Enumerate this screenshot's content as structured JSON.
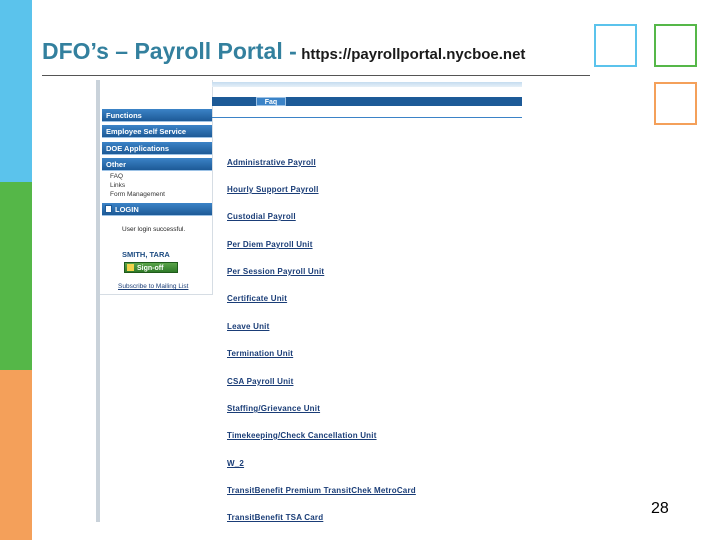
{
  "slide": {
    "title": "DFO’s – Payroll Portal -",
    "url": "https://payrollportal.nycboe.net",
    "page_number": "28",
    "colors": {
      "blue": "#5bc3ec",
      "green": "#55b748",
      "orange": "#f4a05a",
      "title": "#33809e"
    }
  },
  "sidebar": {
    "sections": [
      "Functions",
      "Employee Self Service",
      "DOE Applications",
      "Other"
    ],
    "other_links": [
      "FAQ",
      "Links",
      "Form Management"
    ],
    "login": {
      "header": "LOGIN",
      "message": "User login successful.",
      "user": "SMITH, TARA",
      "signoff_label": "Sign-off",
      "subscribe_link": "Subscribe to Mailing List"
    }
  },
  "content": {
    "tab_label": "Faq",
    "units": [
      "Administrative Payroll",
      "Hourly Support Payroll",
      "Custodial Payroll",
      "Per Diem Payroll Unit",
      "Per Session Payroll Unit",
      "Certificate Unit",
      "Leave Unit",
      "Termination Unit",
      "CSA Payroll Unit",
      "Staffing/Grievance Unit",
      "Timekeeping/Check Cancellation Unit",
      "W_2",
      "TransitBenefit Premium TransitChek MetroCard",
      "TransitBenefit TSA Card"
    ]
  }
}
